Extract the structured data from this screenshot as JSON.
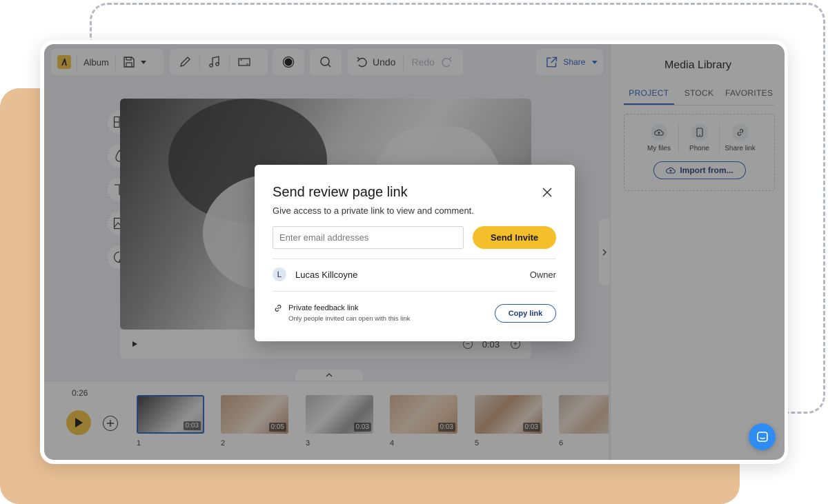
{
  "toolbar": {
    "album_label": "Album",
    "undo_label": "Undo",
    "redo_label": "Redo",
    "share_label": "Share"
  },
  "player": {
    "time": "0:03"
  },
  "timeline": {
    "total_time": "0:26",
    "clips": [
      {
        "number": "1",
        "duration": "0:03",
        "selected": true
      },
      {
        "number": "2",
        "duration": "0:05",
        "selected": false
      },
      {
        "number": "3",
        "duration": "0:03",
        "selected": false
      },
      {
        "number": "4",
        "duration": "0:03",
        "selected": false
      },
      {
        "number": "5",
        "duration": "0:03",
        "selected": false
      },
      {
        "number": "6",
        "duration": "",
        "selected": false
      }
    ]
  },
  "media_library": {
    "title": "Media Library",
    "tabs": [
      "PROJECT",
      "STOCK",
      "FAVORITES"
    ],
    "active_tab": "PROJECT",
    "sources": [
      "My files",
      "Phone",
      "Share link"
    ],
    "import_label": "Import from..."
  },
  "modal": {
    "title": "Send review page link",
    "subtitle": "Give access to a private link to view and comment.",
    "email_placeholder": "Enter email addresses",
    "send_label": "Send Invite",
    "user_initial": "L",
    "user_name": "Lucas Killcoyne",
    "user_role": "Owner",
    "link_title": "Private feedback link",
    "link_subtitle": "Only people invited can open with this link",
    "copy_label": "Copy link"
  },
  "colors": {
    "accent_yellow": "#f4bf2b",
    "accent_blue": "#1f5fbf",
    "backdrop": "#e8bf94",
    "chat_blue": "#2f8cf2"
  }
}
